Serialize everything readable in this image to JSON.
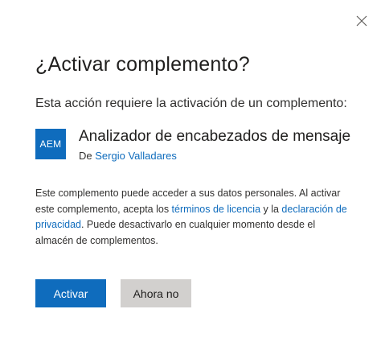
{
  "dialog": {
    "title": "¿Activar complemento?",
    "subtitle": "Esta acción requiere la activación de un complemento:",
    "close_icon": "close-icon"
  },
  "addin": {
    "logo_text": "AEM",
    "logo_color": "#0f6cbd",
    "name": "Analizador de encabezados de mensaje",
    "author_prefix": "De",
    "author_name": "Sergio Valladares"
  },
  "description": {
    "part1": "Este complemento puede acceder a sus datos personales. Al activar este complemento, acepta los ",
    "terms_link": "términos de licencia",
    "part2": " y la ",
    "privacy_link": "declaración de privacidad",
    "part3": ". Puede desactivarlo en cualquier momento desde el almacén de complementos."
  },
  "actions": {
    "primary_label": "Activar",
    "secondary_label": "Ahora no"
  },
  "colors": {
    "accent": "#0f6cbd",
    "secondary_button": "#d2d0ce",
    "text": "#323130"
  }
}
